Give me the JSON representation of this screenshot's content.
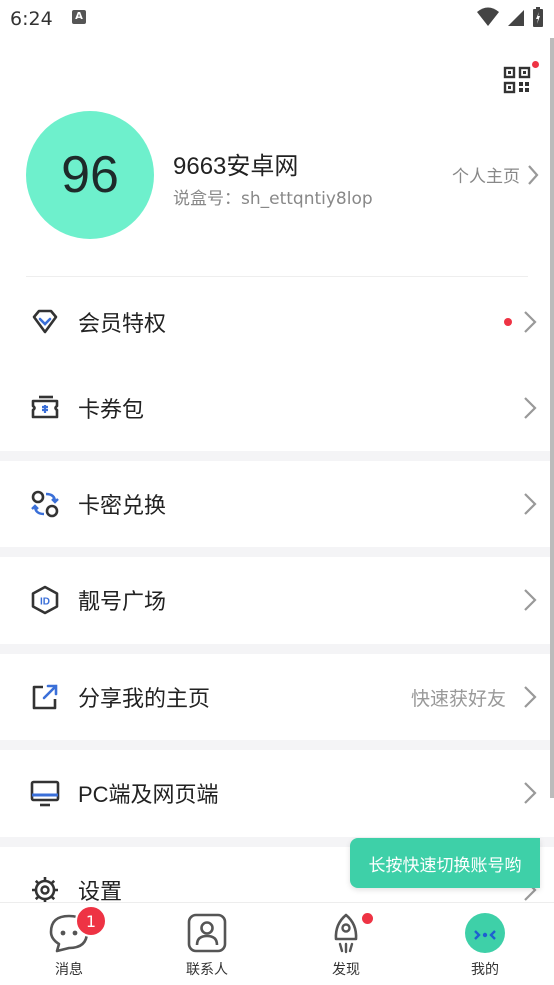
{
  "status_bar": {
    "time": "6:24",
    "notification_icon": "A"
  },
  "profile": {
    "avatar_text": "96",
    "username": "9663安卓网",
    "account_id": "说盒号：sh_ettqntiy8lop",
    "homepage_label": "个人主页"
  },
  "menu": {
    "membership": {
      "label": "会员特权",
      "icon": "diamond-icon"
    },
    "coupons": {
      "label": "卡券包",
      "icon": "ticket-icon"
    },
    "redeem": {
      "label": "卡密兑换",
      "icon": "exchange-icon"
    },
    "vanity_id": {
      "label": "靓号广场",
      "icon": "id-badge-icon"
    },
    "share": {
      "label": "分享我的主页",
      "hint": "快速获好友",
      "icon": "share-icon"
    },
    "pc": {
      "label": "PC端及网页端",
      "icon": "monitor-icon"
    },
    "settings": {
      "label": "设置",
      "icon": "gear-icon"
    }
  },
  "toast": "长按快速切换账号哟",
  "tabs": {
    "messages": {
      "label": "消息",
      "badge": "1"
    },
    "contacts": {
      "label": "联系人"
    },
    "discover": {
      "label": "发现"
    },
    "me": {
      "label": "我的"
    }
  },
  "colors": {
    "accent": "#3ed0a8",
    "avatar_bg": "#6ef0cc",
    "badge_red": "#ee3344",
    "icon_blue": "#3a6fd8"
  }
}
